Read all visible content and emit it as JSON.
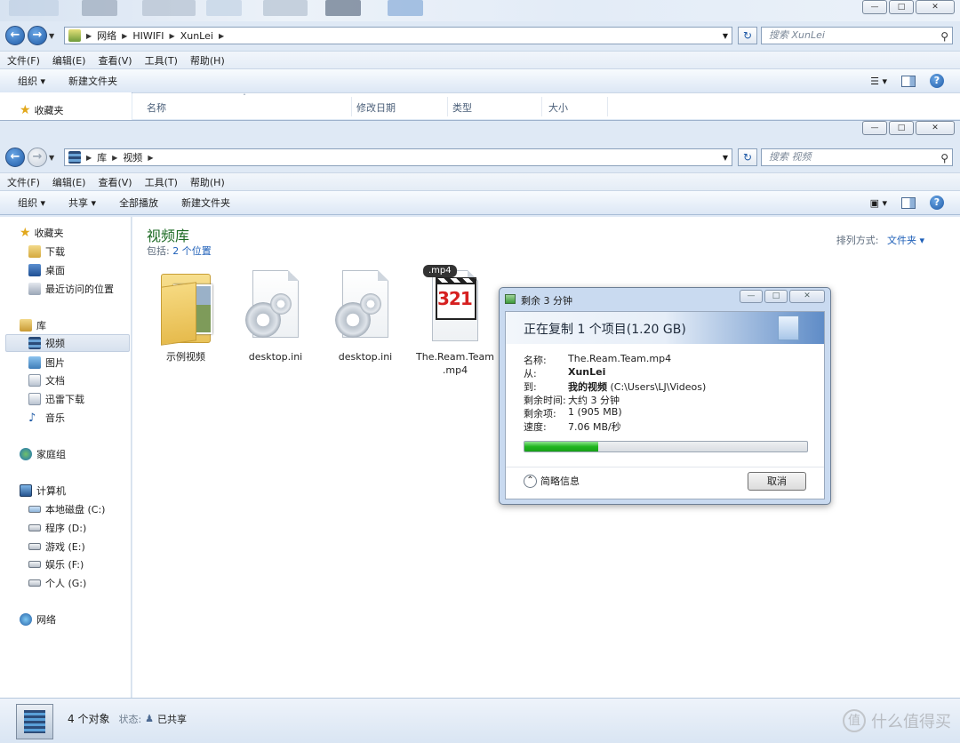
{
  "back_window": {
    "breadcrumb": [
      "网络",
      "HIWIFI",
      "XunLei"
    ],
    "search_placeholder": "搜索 XunLei",
    "menu": [
      "文件(F)",
      "编辑(E)",
      "查看(V)",
      "工具(T)",
      "帮助(H)"
    ],
    "toolbar": {
      "organize": "组织 ▾",
      "new_folder": "新建文件夹"
    },
    "favorites": "收藏夹",
    "columns": [
      "名称",
      "修改日期",
      "类型",
      "大小"
    ]
  },
  "front_window": {
    "breadcrumb": [
      "库",
      "视频"
    ],
    "search_placeholder": "搜索 视频",
    "menu": [
      "文件(F)",
      "编辑(E)",
      "查看(V)",
      "工具(T)",
      "帮助(H)"
    ],
    "toolbar": {
      "organize": "组织 ▾",
      "share": "共享 ▾",
      "play_all": "全部播放",
      "new_folder": "新建文件夹"
    },
    "nav": {
      "favorites": "收藏夹",
      "downloads": "下载",
      "desktop": "桌面",
      "recent": "最近访问的位置",
      "libraries": "库",
      "videos": "视频",
      "pictures": "图片",
      "documents": "文档",
      "thunder": "迅雷下载",
      "music": "音乐",
      "homegroup": "家庭组",
      "computer": "计算机",
      "drive_c": "本地磁盘 (C:)",
      "drive_d": "程序 (D:)",
      "drive_e": "游戏 (E:)",
      "drive_f": "娱乐 (F:)",
      "drive_g": "个人 (G:)",
      "network": "网络"
    },
    "library": {
      "title": "视频库",
      "includes_label": "包括:",
      "includes_link": "2 个位置",
      "arrange_label": "排列方式:",
      "arrange_value": "文件夹 ▾"
    },
    "files": [
      {
        "name": "示例视频"
      },
      {
        "name": "desktop.ini"
      },
      {
        "name": "desktop.ini"
      },
      {
        "name_line1": "The.Ream.Team",
        "name_line2": ".mp4",
        "tag": ".mp4",
        "clap": "321"
      }
    ],
    "status": {
      "count": "4 个对象",
      "state_label": "状态:",
      "state_value": "已共享"
    }
  },
  "copy_dialog": {
    "title": "剩余 3 分钟",
    "heading": "正在复制 1 个项目(1.20 GB)",
    "rows": {
      "name_k": "名称:",
      "name_v": "The.Ream.Team.mp4",
      "from_k": "从:",
      "from_v": "XunLei",
      "to_k": "到:",
      "to_v_bold": "我的视频",
      "to_v_path": " (C:\\Users\\LJ\\Videos)",
      "time_k": "剩余时间:",
      "time_v": "大约 3 分钟",
      "items_k": "剩余项:",
      "items_v": "1 (905 MB)",
      "speed_k": "速度:",
      "speed_v": "7.06 MB/秒"
    },
    "progress": 0.26,
    "less_info": "简略信息",
    "cancel": "取消"
  },
  "watermark": "什么值得买",
  "colors": {
    "accent": "#1e5fb8",
    "library_title": "#1d6a24",
    "progress": "#1fb51f"
  }
}
